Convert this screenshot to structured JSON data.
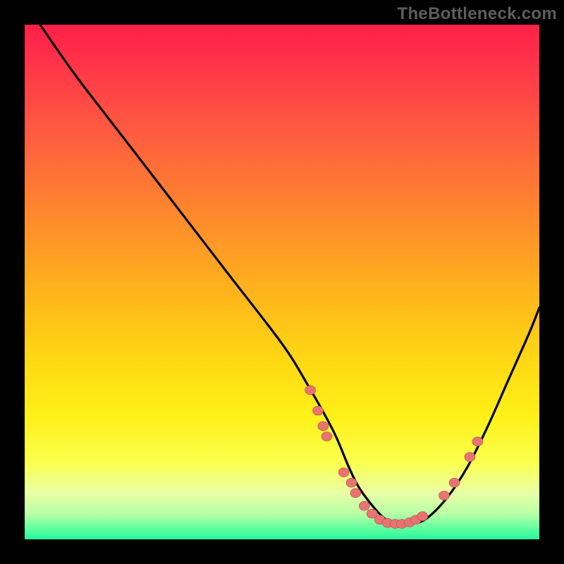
{
  "watermark": "TheBottleneck.com",
  "colors": {
    "background": "#000000",
    "gradient_top": "#ff2048",
    "gradient_mid": "#ffda13",
    "gradient_bottom": "#26f59d",
    "curve_stroke": "#000000",
    "marker_fill": "#e77470",
    "marker_stroke": "#b24b4b"
  },
  "chart_data": {
    "type": "line",
    "title": "",
    "xlabel": "",
    "ylabel": "",
    "xlim": [
      0,
      100
    ],
    "ylim": [
      0,
      100
    ],
    "series": [
      {
        "name": "bottleneck-curve",
        "x": [
          3,
          10,
          20,
          30,
          40,
          50,
          55,
          60,
          63,
          65,
          68,
          70,
          72,
          75,
          78,
          82,
          86,
          90,
          94,
          98,
          100
        ],
        "y": [
          100,
          90,
          77,
          64,
          51,
          38,
          30,
          21,
          14,
          10,
          6,
          4,
          3,
          3,
          4,
          8,
          14,
          22,
          31,
          40,
          45
        ]
      }
    ],
    "markers": [
      {
        "name": "pt-a",
        "x": 55.5,
        "y": 29
      },
      {
        "name": "pt-b",
        "x": 57,
        "y": 25
      },
      {
        "name": "pt-c",
        "x": 58,
        "y": 22
      },
      {
        "name": "pt-d",
        "x": 58.7,
        "y": 20
      },
      {
        "name": "pt-e",
        "x": 62,
        "y": 13
      },
      {
        "name": "pt-f",
        "x": 63.5,
        "y": 11
      },
      {
        "name": "pt-g",
        "x": 64.3,
        "y": 9
      },
      {
        "name": "pt-h",
        "x": 66,
        "y": 6.5
      },
      {
        "name": "pt-i",
        "x": 67.5,
        "y": 5
      },
      {
        "name": "pt-j",
        "x": 69,
        "y": 3.8
      },
      {
        "name": "pt-k",
        "x": 70.5,
        "y": 3.2
      },
      {
        "name": "pt-l",
        "x": 72,
        "y": 3
      },
      {
        "name": "pt-m",
        "x": 73.3,
        "y": 3
      },
      {
        "name": "pt-n",
        "x": 74.8,
        "y": 3.3
      },
      {
        "name": "pt-o",
        "x": 76,
        "y": 3.8
      },
      {
        "name": "pt-p",
        "x": 77.3,
        "y": 4.5
      },
      {
        "name": "pt-q",
        "x": 81.5,
        "y": 8.5
      },
      {
        "name": "pt-r",
        "x": 83.5,
        "y": 11
      },
      {
        "name": "pt-s",
        "x": 86.5,
        "y": 16
      },
      {
        "name": "pt-t",
        "x": 88,
        "y": 19
      }
    ]
  }
}
